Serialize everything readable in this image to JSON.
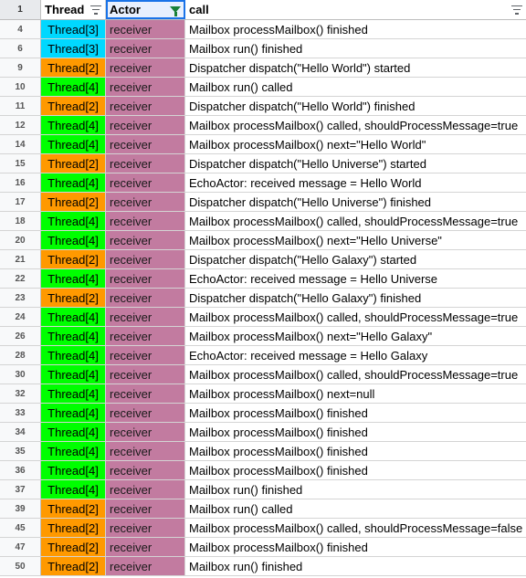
{
  "header": {
    "row_number": "1",
    "thread": "Thread",
    "actor": "Actor",
    "call": "call"
  },
  "colors": {
    "Thread[2]": "#ff9900",
    "Thread[3]": "#00d8ff",
    "Thread[4]": "#00ff00",
    "actor": "#c27ba0"
  },
  "rows": [
    {
      "num": "4",
      "thread": "Thread[3]",
      "actor": "receiver",
      "call": "Mailbox processMailbox() finished"
    },
    {
      "num": "6",
      "thread": "Thread[3]",
      "actor": "receiver",
      "call": "Mailbox run() finished"
    },
    {
      "num": "9",
      "thread": "Thread[2]",
      "actor": "receiver",
      "call": "Dispatcher dispatch(\"Hello World\") started"
    },
    {
      "num": "10",
      "thread": "Thread[4]",
      "actor": "receiver",
      "call": "Mailbox run() called"
    },
    {
      "num": "11",
      "thread": "Thread[2]",
      "actor": "receiver",
      "call": "Dispatcher dispatch(\"Hello World\") finished"
    },
    {
      "num": "12",
      "thread": "Thread[4]",
      "actor": "receiver",
      "call": "Mailbox processMailbox() called, shouldProcessMessage=true"
    },
    {
      "num": "14",
      "thread": "Thread[4]",
      "actor": "receiver",
      "call": "Mailbox processMailbox() next=\"Hello World\""
    },
    {
      "num": "15",
      "thread": "Thread[2]",
      "actor": "receiver",
      "call": "Dispatcher dispatch(\"Hello Universe\") started"
    },
    {
      "num": "16",
      "thread": "Thread[4]",
      "actor": "receiver",
      "call": "EchoActor: received message = Hello World"
    },
    {
      "num": "17",
      "thread": "Thread[2]",
      "actor": "receiver",
      "call": "Dispatcher dispatch(\"Hello Universe\") finished"
    },
    {
      "num": "18",
      "thread": "Thread[4]",
      "actor": "receiver",
      "call": "Mailbox processMailbox() called, shouldProcessMessage=true"
    },
    {
      "num": "20",
      "thread": "Thread[4]",
      "actor": "receiver",
      "call": "Mailbox processMailbox() next=\"Hello Universe\""
    },
    {
      "num": "21",
      "thread": "Thread[2]",
      "actor": "receiver",
      "call": "Dispatcher dispatch(\"Hello Galaxy\") started"
    },
    {
      "num": "22",
      "thread": "Thread[4]",
      "actor": "receiver",
      "call": "EchoActor: received message = Hello Universe"
    },
    {
      "num": "23",
      "thread": "Thread[2]",
      "actor": "receiver",
      "call": "Dispatcher dispatch(\"Hello Galaxy\") finished"
    },
    {
      "num": "24",
      "thread": "Thread[4]",
      "actor": "receiver",
      "call": "Mailbox processMailbox() called, shouldProcessMessage=true"
    },
    {
      "num": "26",
      "thread": "Thread[4]",
      "actor": "receiver",
      "call": "Mailbox processMailbox() next=\"Hello Galaxy\""
    },
    {
      "num": "28",
      "thread": "Thread[4]",
      "actor": "receiver",
      "call": "EchoActor: received message = Hello Galaxy"
    },
    {
      "num": "30",
      "thread": "Thread[4]",
      "actor": "receiver",
      "call": "Mailbox processMailbox() called, shouldProcessMessage=true"
    },
    {
      "num": "32",
      "thread": "Thread[4]",
      "actor": "receiver",
      "call": "Mailbox processMailbox() next=null"
    },
    {
      "num": "33",
      "thread": "Thread[4]",
      "actor": "receiver",
      "call": "Mailbox processMailbox() finished"
    },
    {
      "num": "34",
      "thread": "Thread[4]",
      "actor": "receiver",
      "call": "Mailbox processMailbox() finished"
    },
    {
      "num": "35",
      "thread": "Thread[4]",
      "actor": "receiver",
      "call": "Mailbox processMailbox() finished"
    },
    {
      "num": "36",
      "thread": "Thread[4]",
      "actor": "receiver",
      "call": "Mailbox processMailbox() finished"
    },
    {
      "num": "37",
      "thread": "Thread[4]",
      "actor": "receiver",
      "call": "Mailbox run() finished"
    },
    {
      "num": "39",
      "thread": "Thread[2]",
      "actor": "receiver",
      "call": "Mailbox run() called"
    },
    {
      "num": "45",
      "thread": "Thread[2]",
      "actor": "receiver",
      "call": "Mailbox processMailbox() called, shouldProcessMessage=false"
    },
    {
      "num": "47",
      "thread": "Thread[2]",
      "actor": "receiver",
      "call": "Mailbox processMailbox() finished"
    },
    {
      "num": "50",
      "thread": "Thread[2]",
      "actor": "receiver",
      "call": "Mailbox run() finished"
    }
  ]
}
